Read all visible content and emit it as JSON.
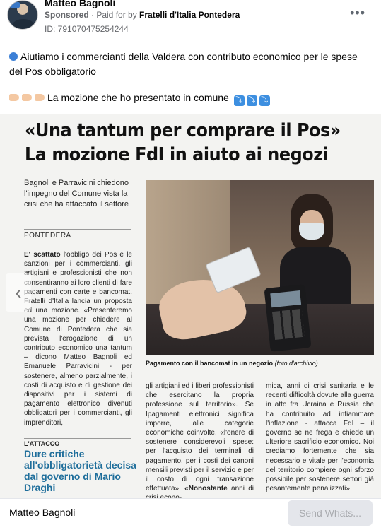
{
  "post": {
    "page_name": "Matteo Bagnoli",
    "sponsored": "Sponsored",
    "paid_for_prefix": " · Paid for by ",
    "payer": "Fratelli d'Italia Pontedera",
    "ad_id": "ID: 791070475254244",
    "more_icon": "ellipsis-icon",
    "text_line1": "Aiutiamo i commercianti della Valdera con contributo economico per le spese del Pos obbligatorio",
    "text_line2": "La mozione che ho presentato in comune",
    "arrow_glyph": "⤵"
  },
  "newspaper": {
    "headline_1": "«Una tantum per comprare il Pos»",
    "headline_2": "La mozione FdI in aiuto ai negozi",
    "subhead": "Bagnoli e Parravicini chiedono l'impegno del Comune vista la crisi che ha attaccato il settore",
    "place": "PONTEDERA",
    "col1_lead": "E' scattato",
    "col1_text": " l'obbligo dei Pos e le sanzioni per i commercianti, gli artigiani e professionisti che non consentiranno ai loro clienti di fare pagamenti con carte e bancomat. Fratelli d'Italia lancia un proposta ed una mozione. «Presenteremo una mozione per chiedere al Comune di Pontedera che sia prevista l'erogazione di un contributo economico una tantum – dicono Matteo Bagnoli ed Emanuele Parravicini - per sostenere, almeno parzialmente, i costi di acquisto e di gestione dei dispositivi per i sistemi di pagamento elettronico divenuti obbligatori per i commercianti, gli imprenditori,",
    "attacco_label": "L'ATTACCO",
    "subhead2": "Dure critiche all'obbligatorietà decisa dal governo di Mario Draghi",
    "caption_bold": "Pagamento con il bancomat in un negozio",
    "caption_italic": " (foto d'archivio)",
    "col2_text": "gli artigiani ed i liberi professionisti che esercitano la propria professione sul territorio». Se Ipagamenti elettronici significa imporre, alle categorie economiche coinvolte, «l'onere di sostenere considerevoli spese: per l'acquisto dei terminali di pagamento, per i costi dei canoni mensili previsti per il servizio e per il costo di ogni transazione effettuata».",
    "col2_tail_bold": "«Nonostante",
    "col2_tail": " anni di crisi econo-",
    "col3_text": "mica, anni di crisi sanitaria e le recenti difficoltà dovute alla guerra in atto fra Ucraina e Russia che ha contribuito ad infiammare l'inflazione - attacca FdI – il governo se ne frega e chiede un ulteriore sacrificio economico. Noi crediamo fortemente che sia necessario e vitale per l'economia del territorio compiere ogni sforzo possibile per sostenere settori già pesantemente penalizzati»"
  },
  "carousel": {
    "prev_glyph": "‹"
  },
  "bottom": {
    "name": "Matteo Bagnoli",
    "send_label": "Send Whats..."
  }
}
